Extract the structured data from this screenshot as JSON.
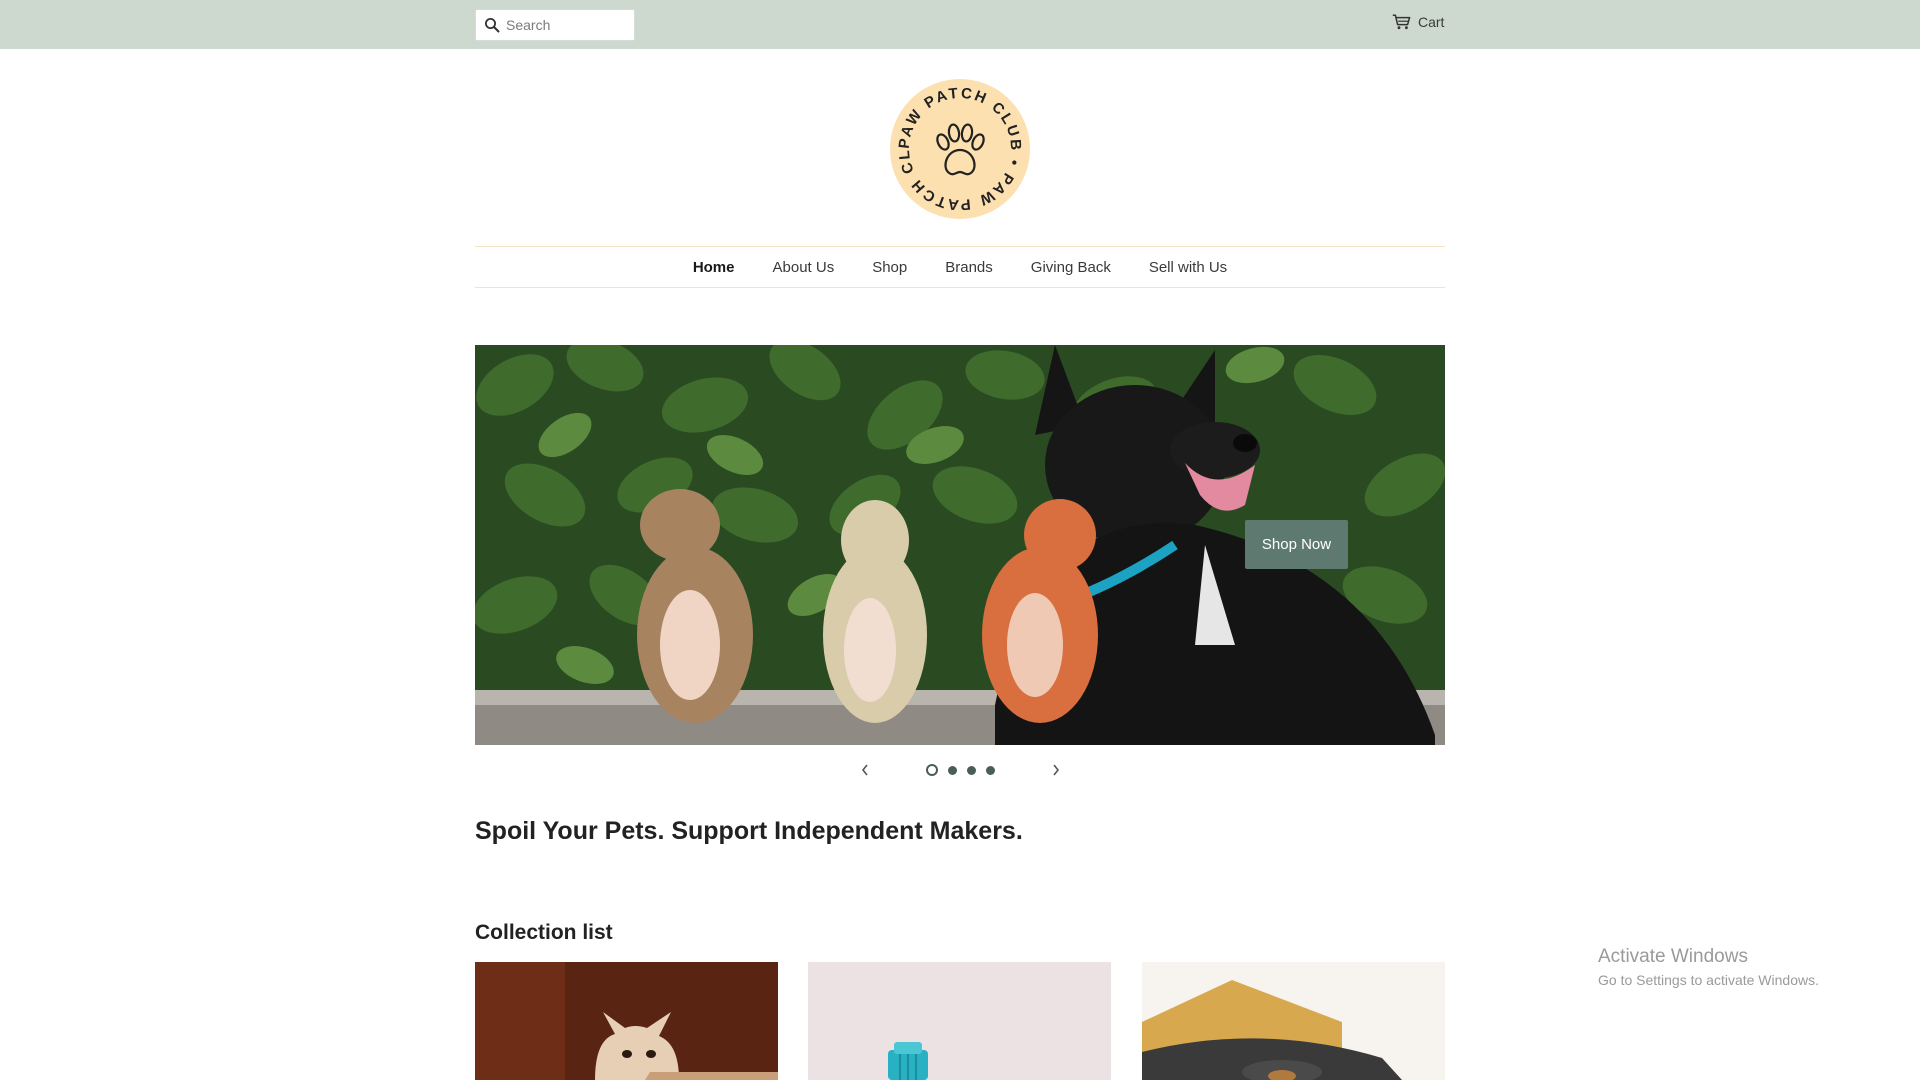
{
  "header": {
    "search": {
      "placeholder": "Search",
      "value": ""
    },
    "cart_label": "Cart"
  },
  "logo": {
    "text": "PAW PATCH CLUB"
  },
  "nav": {
    "items": [
      {
        "label": "Home",
        "active": true
      },
      {
        "label": "About Us"
      },
      {
        "label": "Shop"
      },
      {
        "label": "Brands"
      },
      {
        "label": "Giving Back"
      },
      {
        "label": "Sell with Us"
      }
    ]
  },
  "hero": {
    "button_label": "Shop Now",
    "slide_count": 4,
    "active_slide": 1
  },
  "tagline": "Spoil Your Pets. Support Independent Makers.",
  "collection": {
    "heading": "Collection list"
  },
  "watermark": {
    "title": "Activate Windows",
    "subtitle": "Go to Settings to activate Windows."
  },
  "colors": {
    "topbar": "#cdd8cf",
    "accent": "#5e7a70",
    "logo_fill": "#fde0b0",
    "nav_border": "#f3e2c4"
  },
  "icons": [
    "search-icon",
    "cart-icon",
    "paw-icon",
    "chevron-left-icon",
    "chevron-right-icon"
  ]
}
